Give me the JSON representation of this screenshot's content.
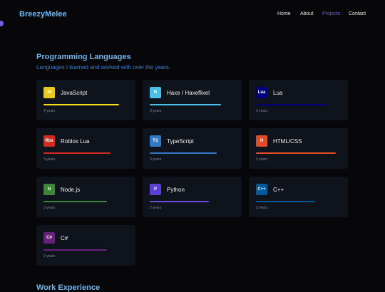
{
  "header": {
    "brand": "BreezyMelee",
    "nav": [
      "Home",
      "About",
      "Projects",
      "Contact"
    ],
    "active_nav": "Projects"
  },
  "section": {
    "title": "Programming Languages",
    "subtitle": "Languages I learned and worked with over the years."
  },
  "languages": [
    {
      "badge": "JS",
      "name": "JavaScript",
      "years": "4 years",
      "level": 0.9,
      "color": "#f7df1e",
      "badge_bg": "#e8c81c",
      "badge_fg": "#ffffff"
    },
    {
      "badge": "R",
      "name": "Haxe / Haxeflixel",
      "years": "3 years",
      "level": 0.85,
      "color": "#4dc1e8",
      "badge_bg": "#4cbfe6",
      "badge_fg": "#ffffff"
    },
    {
      "badge": "Lua",
      "name": "Lua",
      "years": "3 years",
      "level": 0.85,
      "color": "#000080",
      "badge_bg": "#000080",
      "badge_fg": "#ffffff"
    },
    {
      "badge": "Rbx",
      "name": "Roblox Lua",
      "years": "3 years",
      "level": 0.8,
      "color": "#d42b1f",
      "badge_bg": "#d42b1f",
      "badge_fg": "#ffffff"
    },
    {
      "badge": "TS",
      "name": "TypeScript",
      "years": "3 years",
      "level": 0.8,
      "color": "#3178c6",
      "badge_bg": "#3178c6",
      "badge_fg": "#ffffff"
    },
    {
      "badge": "H",
      "name": "HTML/CSS",
      "years": "3 years",
      "level": 0.95,
      "color": "#e34c26",
      "badge_bg": "#e34c26",
      "badge_fg": "#ffffff"
    },
    {
      "badge": "N",
      "name": "Node.js",
      "years": "3 years",
      "level": 0.75,
      "color": "#3c873a",
      "badge_bg": "#3c873a",
      "badge_fg": "#ffffff"
    },
    {
      "badge": "P",
      "name": "Python",
      "years": "2 years",
      "level": 0.7,
      "color": "#6a4fe0",
      "badge_bg": "#5b3fd6",
      "badge_fg": "#ffffff"
    },
    {
      "badge": "C++",
      "name": "C++",
      "years": "2 years",
      "level": 0.7,
      "color": "#00599c",
      "badge_bg": "#00599c",
      "badge_fg": "#ffffff"
    },
    {
      "badge": "C#",
      "name": "C#",
      "years": "2 years",
      "level": 0.75,
      "color": "#68217a",
      "badge_bg": "#68217a",
      "badge_fg": "#ffffff"
    }
  ],
  "next_section": {
    "title": "Work Experience"
  }
}
